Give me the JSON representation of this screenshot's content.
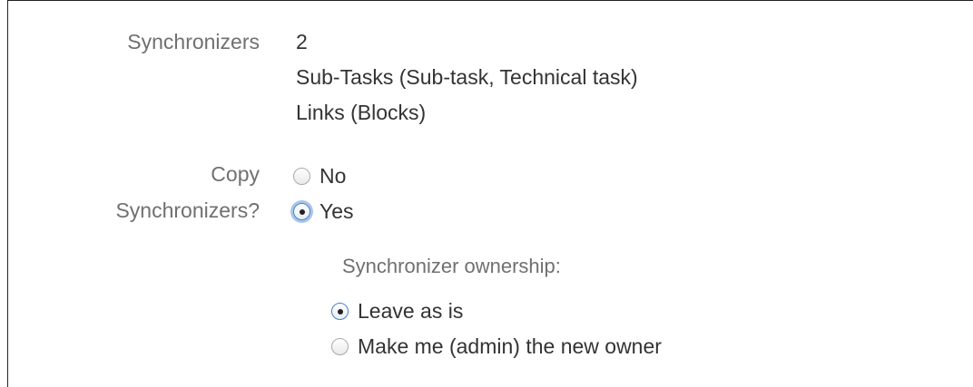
{
  "synchronizers": {
    "label": "Synchronizers",
    "count": "2",
    "items": [
      "Sub-Tasks (Sub-task, Technical task)",
      "Links (Blocks)"
    ]
  },
  "copy_synchronizers": {
    "label_line1": "Copy",
    "label_line2": "Synchronizers?",
    "options": [
      {
        "label": "No",
        "selected": false
      },
      {
        "label": "Yes",
        "selected": true
      }
    ]
  },
  "ownership": {
    "label": "Synchronizer ownership:",
    "options": [
      {
        "label": "Leave as is",
        "selected": true
      },
      {
        "label": "Make me (admin) the new owner",
        "selected": false
      }
    ]
  }
}
